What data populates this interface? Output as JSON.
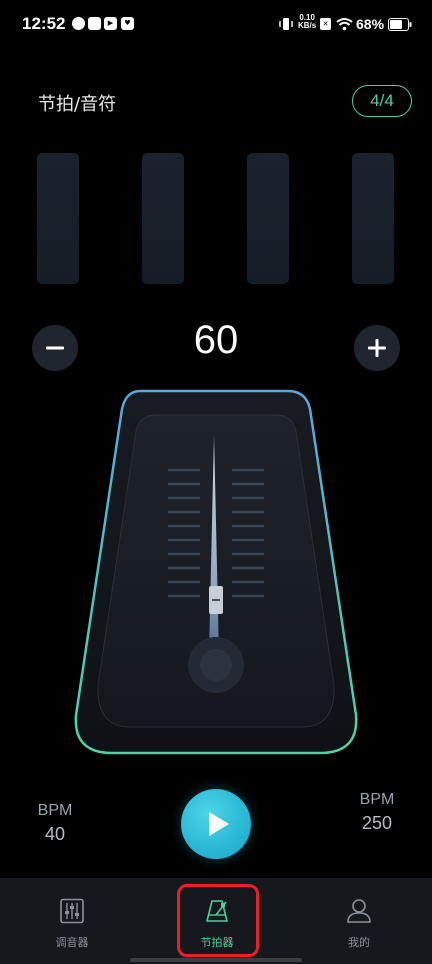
{
  "status_bar": {
    "time": "12:52",
    "net_speed_value": "0.10",
    "net_speed_unit": "KB/s",
    "battery": "68%"
  },
  "header": {
    "title": "节拍/音符",
    "time_signature": "4/4"
  },
  "tempo": {
    "value": "60",
    "minus_symbol": "−",
    "plus_symbol": "+"
  },
  "bpm_range": {
    "min_label": "BPM",
    "min_value": "40",
    "max_label": "BPM",
    "max_value": "250"
  },
  "bottom_nav": {
    "items": [
      {
        "label": "调音器",
        "icon": "tuner-sliders-icon"
      },
      {
        "label": "节拍器",
        "icon": "metronome-icon",
        "active": true
      },
      {
        "label": "我的",
        "icon": "user-icon"
      }
    ]
  },
  "colors": {
    "accent": "#4ecf9c",
    "play_button": "#2bbad6",
    "highlight": "#e8202a"
  }
}
